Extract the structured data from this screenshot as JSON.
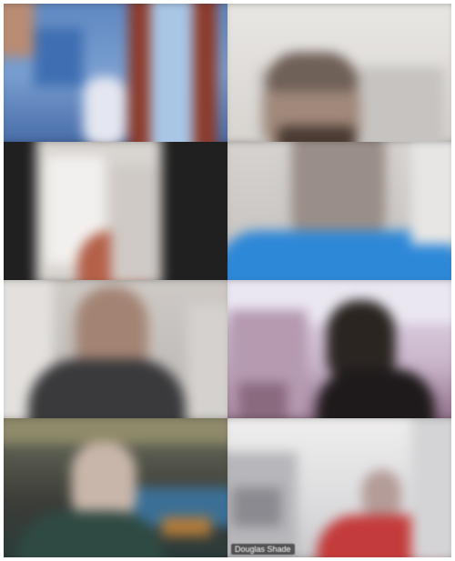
{
  "window": {
    "title": ""
  },
  "participants": [
    {
      "tile": "tile-1",
      "name": "",
      "bg_color": "#5d86c0"
    },
    {
      "tile": "tile-2",
      "name": "",
      "bg_color": "#e9e7e4"
    },
    {
      "tile": "tile-3",
      "name": "",
      "bg_color": "#202020"
    },
    {
      "tile": "tile-4",
      "name": "",
      "bg_color": "#2f86d6"
    },
    {
      "tile": "tile-5",
      "name": "",
      "bg_color": "#cfcac6"
    },
    {
      "tile": "tile-6",
      "name": "",
      "bg_color": "#c9b5c9"
    },
    {
      "tile": "tile-7",
      "name": "",
      "bg_color": "#3b3c37"
    },
    {
      "tile": "tile-8",
      "name": "Douglas Shade",
      "bg_color": "#f0efee"
    }
  ]
}
